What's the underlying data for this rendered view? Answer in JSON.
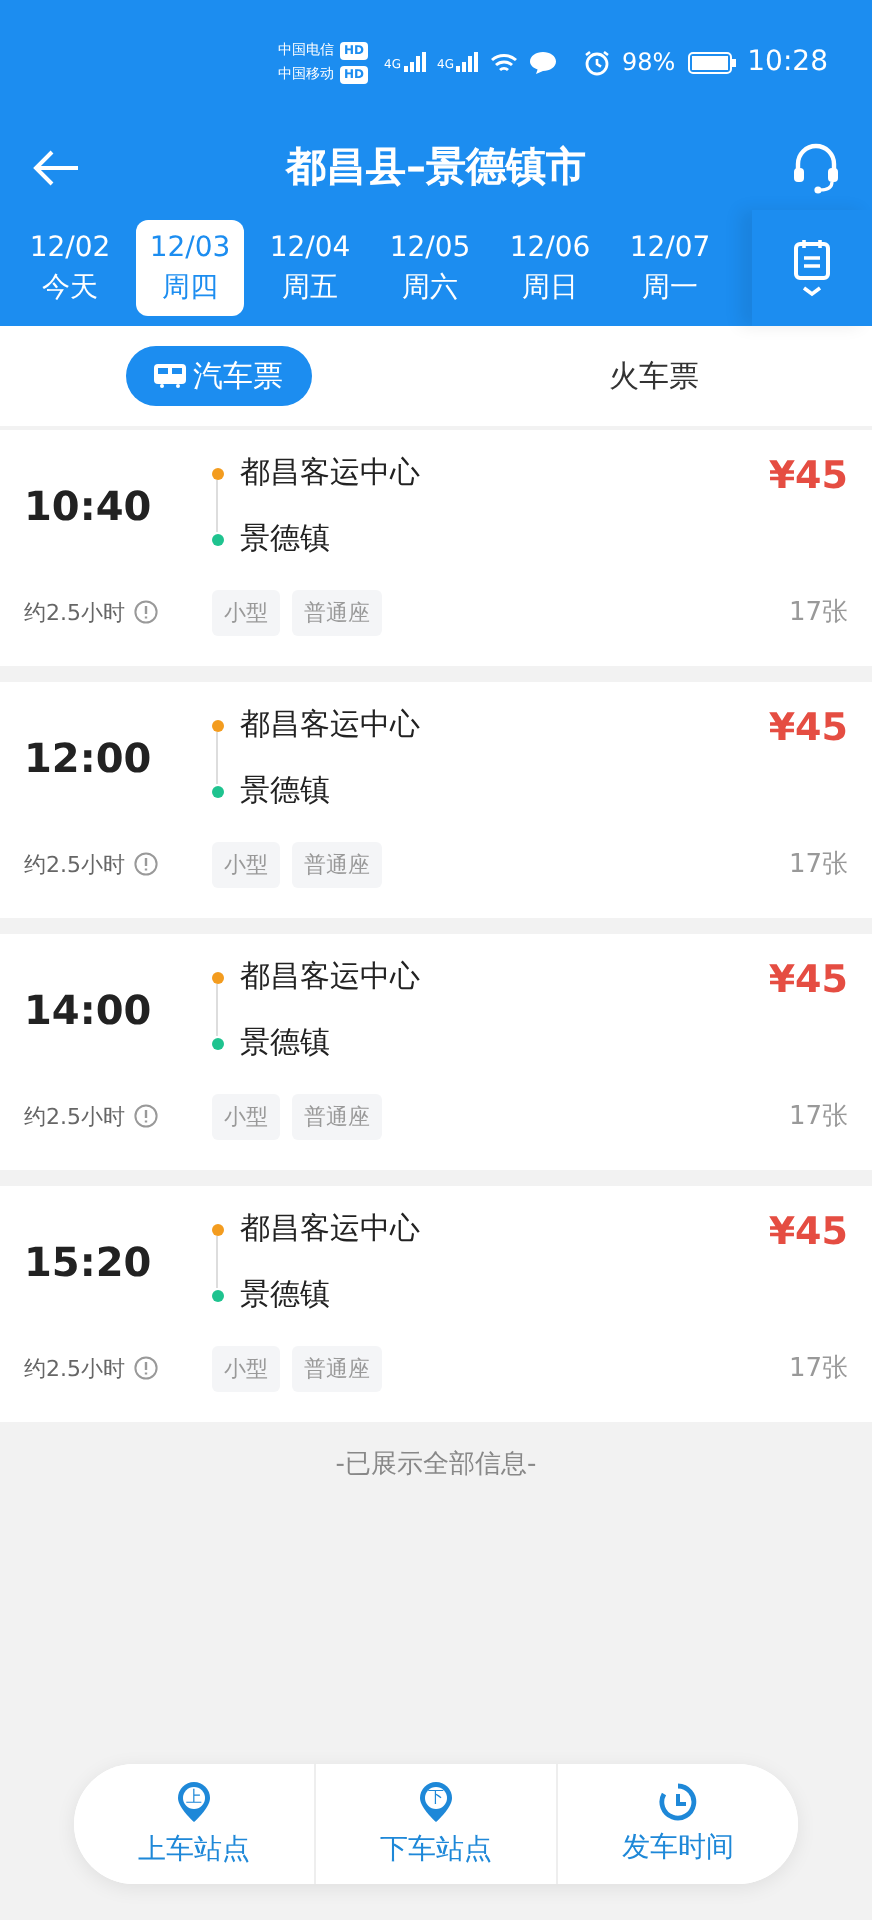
{
  "status_bar": {
    "carriers": [
      {
        "name": "中国电信",
        "badge": "HD",
        "network": "4G"
      },
      {
        "name": "中国移动",
        "badge": "HD",
        "network": "4G"
      }
    ],
    "battery": "98%",
    "time": "10:28"
  },
  "header": {
    "title": "都昌县–景德镇市"
  },
  "dates": [
    {
      "date": "12/02",
      "day": "今天",
      "selected": false
    },
    {
      "date": "12/03",
      "day": "周四",
      "selected": true
    },
    {
      "date": "12/04",
      "day": "周五",
      "selected": false
    },
    {
      "date": "12/05",
      "day": "周六",
      "selected": false
    },
    {
      "date": "12/06",
      "day": "周日",
      "selected": false
    },
    {
      "date": "12/07",
      "day": "周一",
      "selected": false
    }
  ],
  "ticket_tabs": [
    {
      "label": "汽车票",
      "selected": true
    },
    {
      "label": "火车票",
      "selected": false
    }
  ],
  "trips": [
    {
      "time": "10:40",
      "from": "都昌客运中心",
      "to": "景德镇",
      "price": "¥45",
      "duration": "约2.5小时",
      "tags": [
        "小型",
        "普通座"
      ],
      "seats": "17张"
    },
    {
      "time": "12:00",
      "from": "都昌客运中心",
      "to": "景德镇",
      "price": "¥45",
      "duration": "约2.5小时",
      "tags": [
        "小型",
        "普通座"
      ],
      "seats": "17张"
    },
    {
      "time": "14:00",
      "from": "都昌客运中心",
      "to": "景德镇",
      "price": "¥45",
      "duration": "约2.5小时",
      "tags": [
        "小型",
        "普通座"
      ],
      "seats": "17张"
    },
    {
      "time": "15:20",
      "from": "都昌客运中心",
      "to": "景德镇",
      "price": "¥45",
      "duration": "约2.5小时",
      "tags": [
        "小型",
        "普通座"
      ],
      "seats": "17张"
    }
  ],
  "end_note": "-已展示全部信息-",
  "bottom_bar": [
    {
      "kind": "pin",
      "mark": "上",
      "label": "上车站点"
    },
    {
      "kind": "pin",
      "mark": "下",
      "label": "下车站点"
    },
    {
      "kind": "clock",
      "label": "发车时间"
    }
  ]
}
